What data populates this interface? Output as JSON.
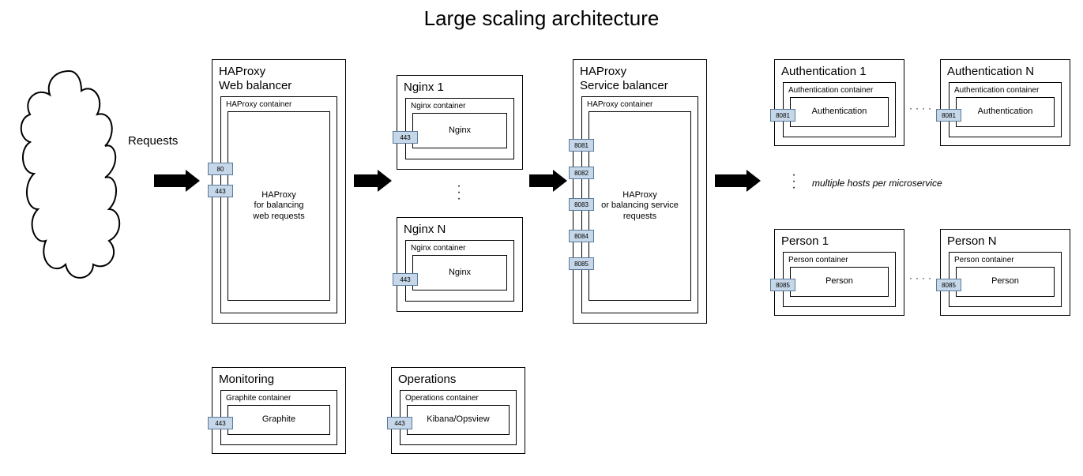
{
  "title": "Large scaling architecture",
  "requests_label": "Requests",
  "note": "multiple hosts per microservice",
  "haproxy_web": {
    "title_l1": "HAProxy",
    "title_l2": "Web balancer",
    "container": "HAProxy container",
    "inner_l1": "HAProxy",
    "inner_l2": "for balancing",
    "inner_l3": "web requests",
    "ports": [
      "80",
      "443"
    ]
  },
  "nginx1": {
    "title": "Nginx 1",
    "container": "Nginx container",
    "inner": "Nginx",
    "port": "443"
  },
  "nginxN": {
    "title": "Nginx N",
    "container": "Nginx container",
    "inner": "Nginx",
    "port": "443"
  },
  "haproxy_svc": {
    "title_l1": "HAProxy",
    "title_l2": "Service balancer",
    "container": "HAProxy container",
    "inner_l1": "HAProxy",
    "inner_l2": "or balancing service",
    "inner_l3": "requests",
    "ports": [
      "8081",
      "8082",
      "8083",
      "8084",
      "8085"
    ]
  },
  "auth1": {
    "title": "Authentication 1",
    "container": "Authentication container",
    "inner": "Authentication",
    "port": "8081"
  },
  "authN": {
    "title": "Authentication N",
    "container": "Authentication container",
    "inner": "Authentication",
    "port": "8081"
  },
  "person1": {
    "title": "Person 1",
    "container": "Person container",
    "inner": "Person",
    "port": "8085"
  },
  "personN": {
    "title": "Person N",
    "container": "Person container",
    "inner": "Person",
    "port": "8085"
  },
  "monitoring": {
    "title": "Monitoring",
    "container": "Graphite container",
    "inner": "Graphite",
    "port": "443"
  },
  "operations": {
    "title": "Operations",
    "container": "Operations container",
    "inner": "Kibana/Opsview",
    "port": "443"
  }
}
